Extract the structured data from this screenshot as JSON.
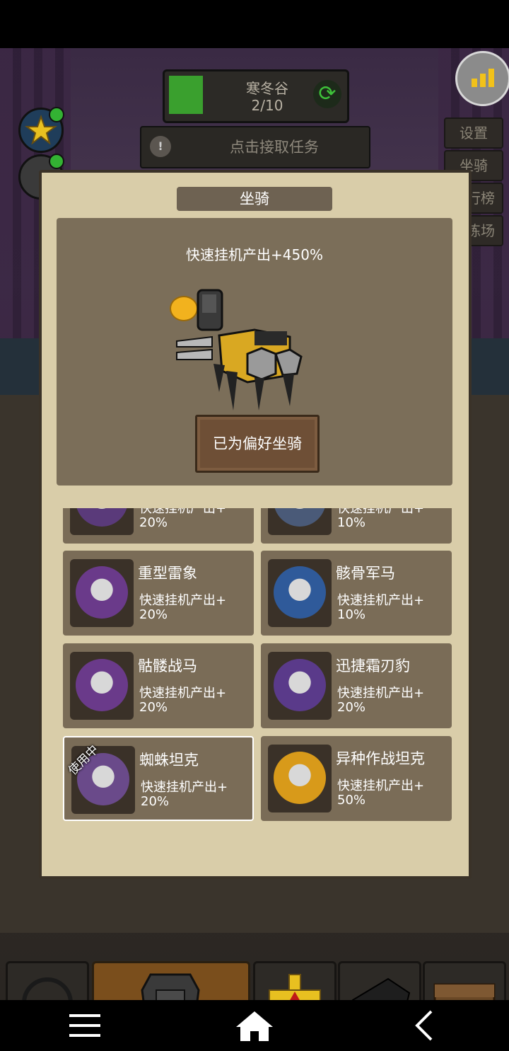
{
  "background": {
    "stage_name": "寒冬谷",
    "stage_progress": "2/10",
    "stage_progress_fraction": 0.2,
    "quest_button": "点击接取任务",
    "side_buttons": [
      "设置",
      "坐骑",
      "排行榜",
      "训练场"
    ]
  },
  "panel": {
    "title": "坐骑",
    "preview": {
      "bonus_text": "快速挂机产出+450%",
      "preferred_label": "已为偏好坐骑"
    },
    "mounts": [
      {
        "name": "",
        "bonus_line1": "快速挂机产出+",
        "bonus_line2": "20%",
        "color": "#5a3a7a",
        "selected": false,
        "partial": true
      },
      {
        "name": "",
        "bonus_line1": "快速挂机产出+",
        "bonus_line2": "10%",
        "color": "#4a5a78",
        "selected": false,
        "partial": true
      },
      {
        "name": "重型雷象",
        "bonus_line1": "快速挂机产出+",
        "bonus_line2": "20%",
        "color": "#6a3a8a",
        "selected": false
      },
      {
        "name": "骸骨军马",
        "bonus_line1": "快速挂机产出+",
        "bonus_line2": "10%",
        "color": "#2f5a9a",
        "selected": false
      },
      {
        "name": "骷髅战马",
        "bonus_line1": "快速挂机产出+",
        "bonus_line2": "20%",
        "color": "#6a3a8a",
        "selected": false
      },
      {
        "name": "迅捷霜刃豹",
        "bonus_line1": "快速挂机产出+",
        "bonus_line2": "20%",
        "color": "#5a3a8a",
        "selected": false
      },
      {
        "name": "蜘蛛坦克",
        "bonus_line1": "快速挂机产出+",
        "bonus_line2": "20%",
        "color": "#6a4a8a",
        "selected": true,
        "badge": "使用中"
      },
      {
        "name": "异种作战坦克",
        "bonus_line1": "快速挂机产出+",
        "bonus_line2": "50%",
        "color": "#d89a1a",
        "selected": false
      }
    ]
  },
  "colors": {
    "panel_bg": "#d9cda9",
    "card_bg": "#7a6c57",
    "accent_yellow": "#f2c21a"
  },
  "nav": {
    "menu_icon": "menu-icon",
    "home_icon": "home-icon",
    "back_icon": "back-icon"
  }
}
